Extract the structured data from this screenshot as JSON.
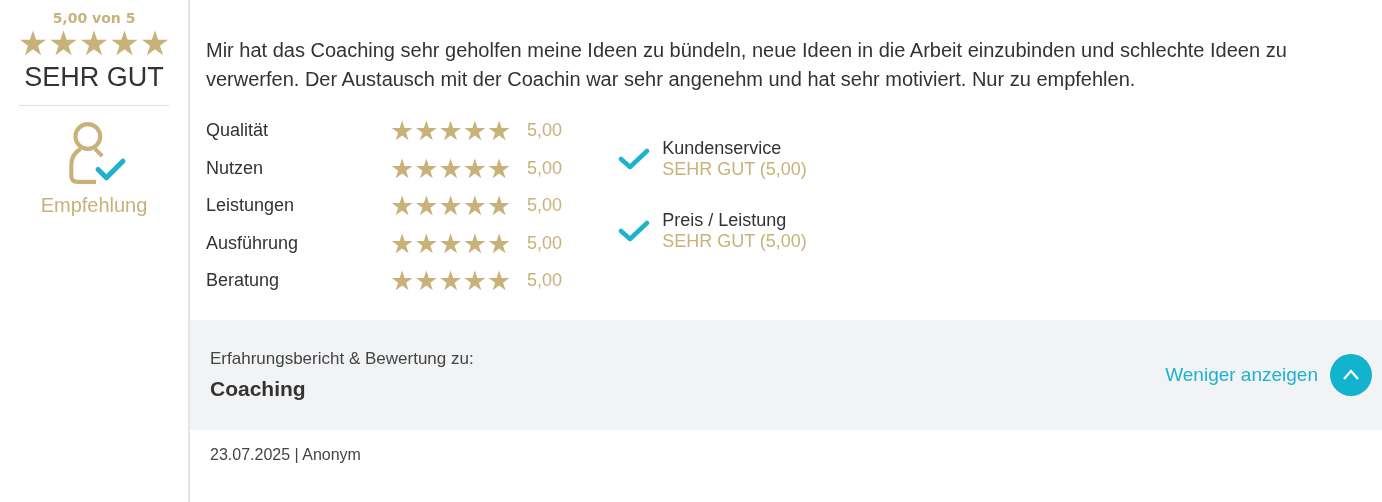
{
  "summary": {
    "score_text": "5,00 von 5",
    "stars": 5,
    "verdict": "SEHR GUT",
    "recommendation": "Empfehlung"
  },
  "review": {
    "text": "Mir hat das Coaching sehr geholfen meine Ideen zu bündeln, neue Ideen in die Arbeit einzubinden und schlechte Ideen zu verwerfen. Der Austausch mit der Coachin war sehr angenehm und hat sehr motiviert. Nur zu empfehlen.",
    "ratings": [
      {
        "label": "Qualität",
        "stars": 5,
        "value": "5,00"
      },
      {
        "label": "Nutzen",
        "stars": 5,
        "value": "5,00"
      },
      {
        "label": "Leistungen",
        "stars": 5,
        "value": "5,00"
      },
      {
        "label": "Ausführung",
        "stars": 5,
        "value": "5,00"
      },
      {
        "label": "Beratung",
        "stars": 5,
        "value": "5,00"
      }
    ],
    "checks": [
      {
        "label": "Kundenservice",
        "verdict": "SEHR GUT (5,00)"
      },
      {
        "label": "Preis / Leistung",
        "verdict": "SEHR GUT (5,00)"
      }
    ]
  },
  "footer_band": {
    "caption": "Erfahrungsbericht & Bewertung zu:",
    "subject": "Coaching",
    "toggle_label": "Weniger anzeigen"
  },
  "meta": "23.07.2025 | Anonym"
}
